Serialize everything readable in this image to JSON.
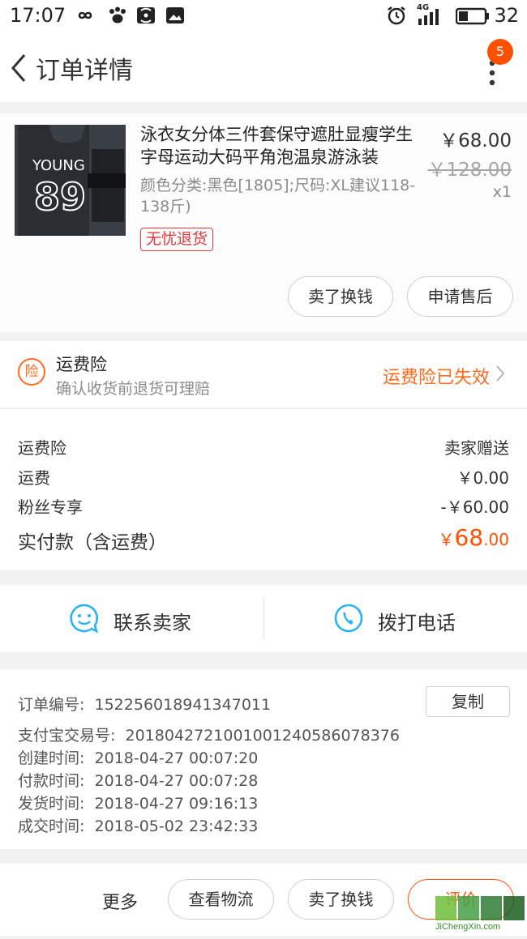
{
  "status_bar": {
    "time": "17:07",
    "battery": "32",
    "network": "4G"
  },
  "nav": {
    "title": "订单详情",
    "badge_count": "5"
  },
  "product": {
    "name": "泳衣女分体三件套保守遮肚显瘦学生字母运动大码平角泡温泉游泳装",
    "sku": "颜色分类:黑色[1805];尺码:XL建议118-138斤)",
    "tag": "无忧退货",
    "price": "￥68.00",
    "original_price": "￥128.00",
    "quantity": "x1",
    "image_text": {
      "line1": "YOUNG",
      "number": "89"
    },
    "buttons": {
      "sell": "卖了换钱",
      "after_sale": "申请售后"
    }
  },
  "insurance": {
    "icon_char": "险",
    "title": "运费险",
    "subtitle": "确认收货前退货可理赔",
    "status": "运费险已失效"
  },
  "fees": {
    "rows": [
      {
        "label": "运费险",
        "value": "卖家赠送"
      },
      {
        "label": "运费",
        "value": "￥0.00"
      },
      {
        "label": "粉丝专享",
        "value": "-￥60.00"
      }
    ],
    "total_label": "实付款（含运费）",
    "total_yen": "￥",
    "total_int": "68",
    "total_dec": ".00"
  },
  "contact": {
    "seller": "联系卖家",
    "phone": "拨打电话"
  },
  "order_info": {
    "copy_label": "复制",
    "rows": [
      {
        "label": "订单编号:",
        "value": "152256018941347011"
      },
      {
        "label": "支付宝交易号:",
        "value": "2018042721001001240586078376"
      },
      {
        "label": "创建时间:",
        "value": "2018-04-27 00:07:20"
      },
      {
        "label": "付款时间:",
        "value": "2018-04-27 00:07:28"
      },
      {
        "label": "发货时间:",
        "value": "2018-04-27 09:16:13"
      },
      {
        "label": "成交时间:",
        "value": "2018-05-02 23:42:33"
      }
    ]
  },
  "bottom_bar": {
    "more": "更多",
    "logistics": "查看物流",
    "sell": "卖了换钱",
    "review": "评价"
  },
  "watermark": {
    "text": "JiChengXin.com"
  },
  "colors": {
    "accent": "#ff5000",
    "insurance": "#ff6a1c",
    "tag_red": "#e4393c",
    "contact_blue": "#2bb3f0"
  }
}
